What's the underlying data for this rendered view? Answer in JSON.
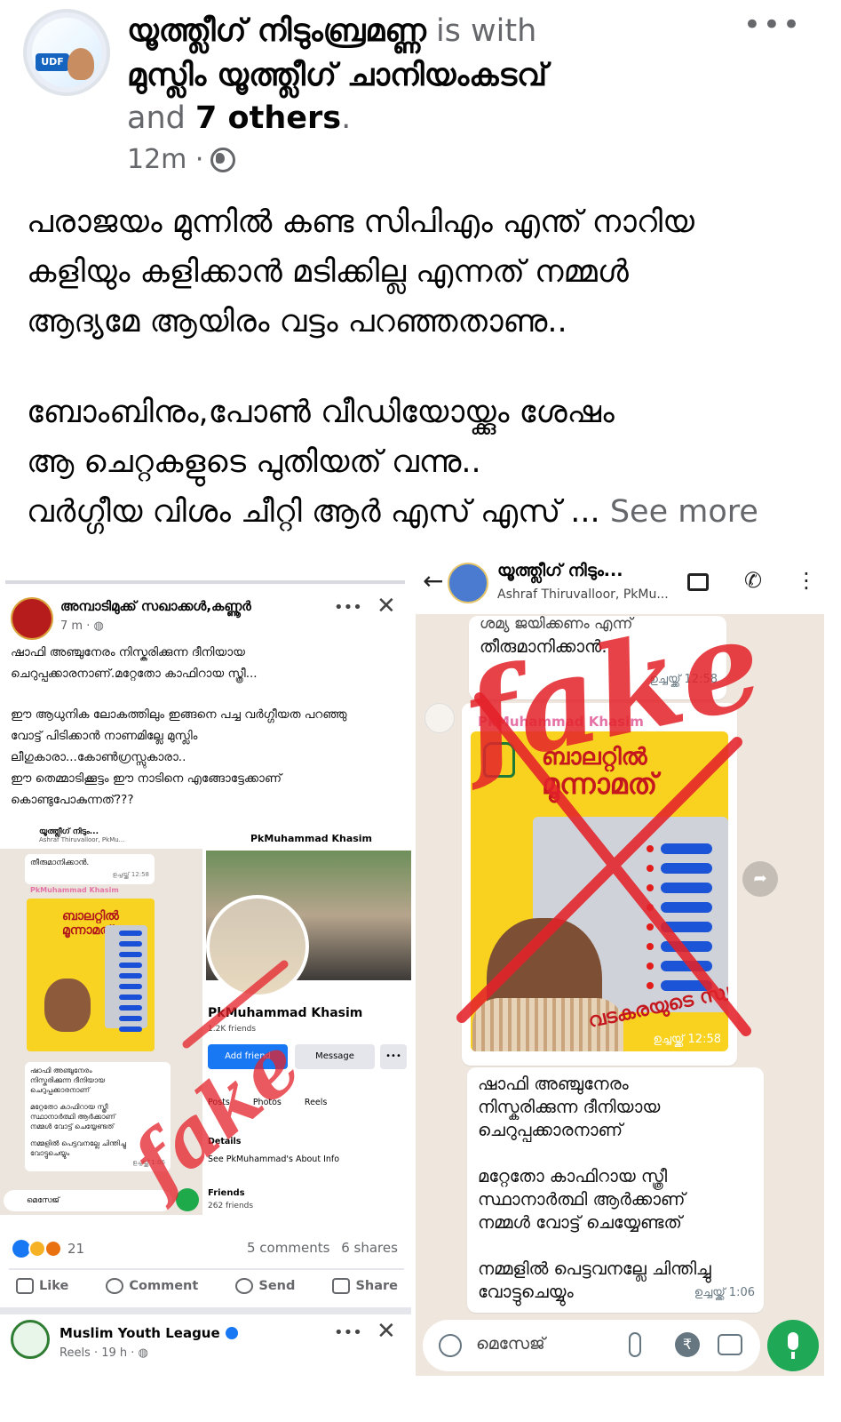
{
  "post": {
    "author": "യൂത്ത്ലീഗ് നിടുംബ്രമണ്ണ",
    "is_with": "is with",
    "tagged": "മുസ്ലിം യൂത്ത്ലീഗ് ചാനിയംകടവ്",
    "and_word": "and",
    "others": "7 others",
    "period": ".",
    "time": "12m ·",
    "more_icon": "•••",
    "body": [
      "പരാജയം മുന്നിൽ കണ്ട സിപിഎം എന്ത് നാറിയ",
      "കളിയും കളിക്കാൻ മടിക്കില്ല എന്നത് നമ്മൾ",
      "ആദ്യമേ ആയിരം വട്ടം പറഞ്ഞതാണു..",
      "ബോംബിനും,പോൺ വീഡിയോയ്ക്കും ശേഷം",
      "ആ ചെറ്റകളുടെ പുതിയത് വന്നു..",
      "വർഗ്ഗീയ വിശം ചീറ്റി ആർ എസ് എസ് ..."
    ],
    "see_more": "See more",
    "avatar_badge": "UDF"
  },
  "fb_shot": {
    "page_name": "അമ്പാടിമുക്ക് സഖാക്കൾ,കണ്ണൂർ",
    "time": "7 m · ",
    "more": "•••",
    "close": "✕",
    "text": [
      "ഷാഫി അഞ്ചുനേരം നിസ്കരിക്കുന്ന ദീനിയായ",
      "ചെറുപ്പക്കാരനാണ്.മറ്റേതോ കാഫിറായ സ്ത്രീ...",
      "ഈ ആധുനിക ലോകത്തിലും ഇങ്ങനെ പച്ച വർഗ്ഗീയത പറഞ്ഞു",
      "വോട്ട് പിടിക്കാൻ നാണമില്ലേ മുസ്ലിം",
      "ലീഗുകാരാ...കോൺഗ്രസ്സുകാരാ..",
      "ഈ തെമ്മാടിക്കൂട്ടം ഈ നാടിനെ എങ്ങോട്ടേക്കാണ്",
      "കൊണ്ടുപോകുന്നത്???"
    ],
    "mini_wa": {
      "title": "യൂത്ത്ലീഗ് നിടും...",
      "sub": "Ashraf Thiruvalloor, PkMu...",
      "bubble1": "തീരുമാനിക്കാൻ.",
      "time1": "ഉച്ചയ്ക്ക് 12:58",
      "sender": "PkMuhammad Khasim",
      "poster_title": "ബാലറ്റിൽ മൂന്നാമത്",
      "msg": [
        "ഷാഫി അഞ്ചുനേരം",
        "നിസ്കരിക്കുന്ന ദീനിയായ",
        "ചെറുപ്പക്കാരനാണ്",
        "മറ്റേതോ കാഫിറായ സ്ത്രീ",
        "സ്ഥാനാർത്ഥി ആർക്കാണ്",
        "നമ്മൾ വോട്ട് ചെയ്യേണ്ടത്",
        "നമ്മളിൽ പെട്ടവനല്ലേ ചിന്തിച്ചു",
        "വോട്ടുചെയ്യും"
      ],
      "time2": "ഉച്ചയ്ക്ക് 1:06",
      "placeholder": "മെസേജ്"
    },
    "mini_profile": {
      "title": "PkMuhammad Khasim",
      "name": "PkMuhammad Khasim",
      "friends": "1.2K friends",
      "add_friend": "Add friend",
      "message": "Message",
      "more": "•••",
      "tabs": [
        "Posts",
        "Photos",
        "Reels"
      ],
      "details": "Details",
      "about": "See PkMuhammad's About Info",
      "friends_h": "Friends",
      "friends_n": "262 friends"
    },
    "reaction_count": "21",
    "comments": "5 comments",
    "shares": "6 shares",
    "actions": [
      "Like",
      "Comment",
      "Send",
      "Share"
    ],
    "next_page": "Muslim Youth League",
    "next_sub": "Reels · 19 h · "
  },
  "wa_shot": {
    "title": "യൂത്ത്ലീഗ് നിടും...",
    "subtitle": "Ashraf Thiruvalloor, PkMu...",
    "bubble_top_1": "ശമ്യ ജയിക്കണം എന്ന്",
    "bubble_top_2": "തീരുമാനിക്കാൻ.",
    "time1": "ഉച്ചയ്ക്ക് 12:58",
    "sender": "PkMuhammad Khasim",
    "poster_title_1": "ബാലറ്റിൽ",
    "poster_title_2": "മൂന്നാമത്",
    "poster_slogan": "വടകരയുടെ സ്വന്തം ഷാഫി",
    "time2": "ഉച്ചയ്ക്ക് 12:58",
    "msg": [
      "ഷാഫി അഞ്ചുനേരം",
      "നിസ്കരിക്കുന്ന ദീനിയായ",
      "ചെറുപ്പക്കാരനാണ്",
      "മറ്റേതോ കാഫിറായ സ്ത്രീ",
      "സ്ഥാനാർത്ഥി ആർക്കാണ്",
      "നമ്മൾ വോട്ട് ചെയ്യേണ്ടത്",
      "നമ്മളിൽ പെട്ടവനല്ലേ ചിന്തിച്ചു",
      "വോട്ടുചെയ്യും"
    ],
    "time3": "ഉച്ചയ്ക്ക് 1:06",
    "placeholder": "മെസേജ്",
    "rupee": "₹"
  },
  "overlay": {
    "word": "fake",
    "color": "#e4222a"
  },
  "colors": {
    "meta_gray": "#65676b",
    "fb_blue": "#1877f2",
    "wa_green": "#1fa855",
    "wa_bg": "#efe7de"
  }
}
